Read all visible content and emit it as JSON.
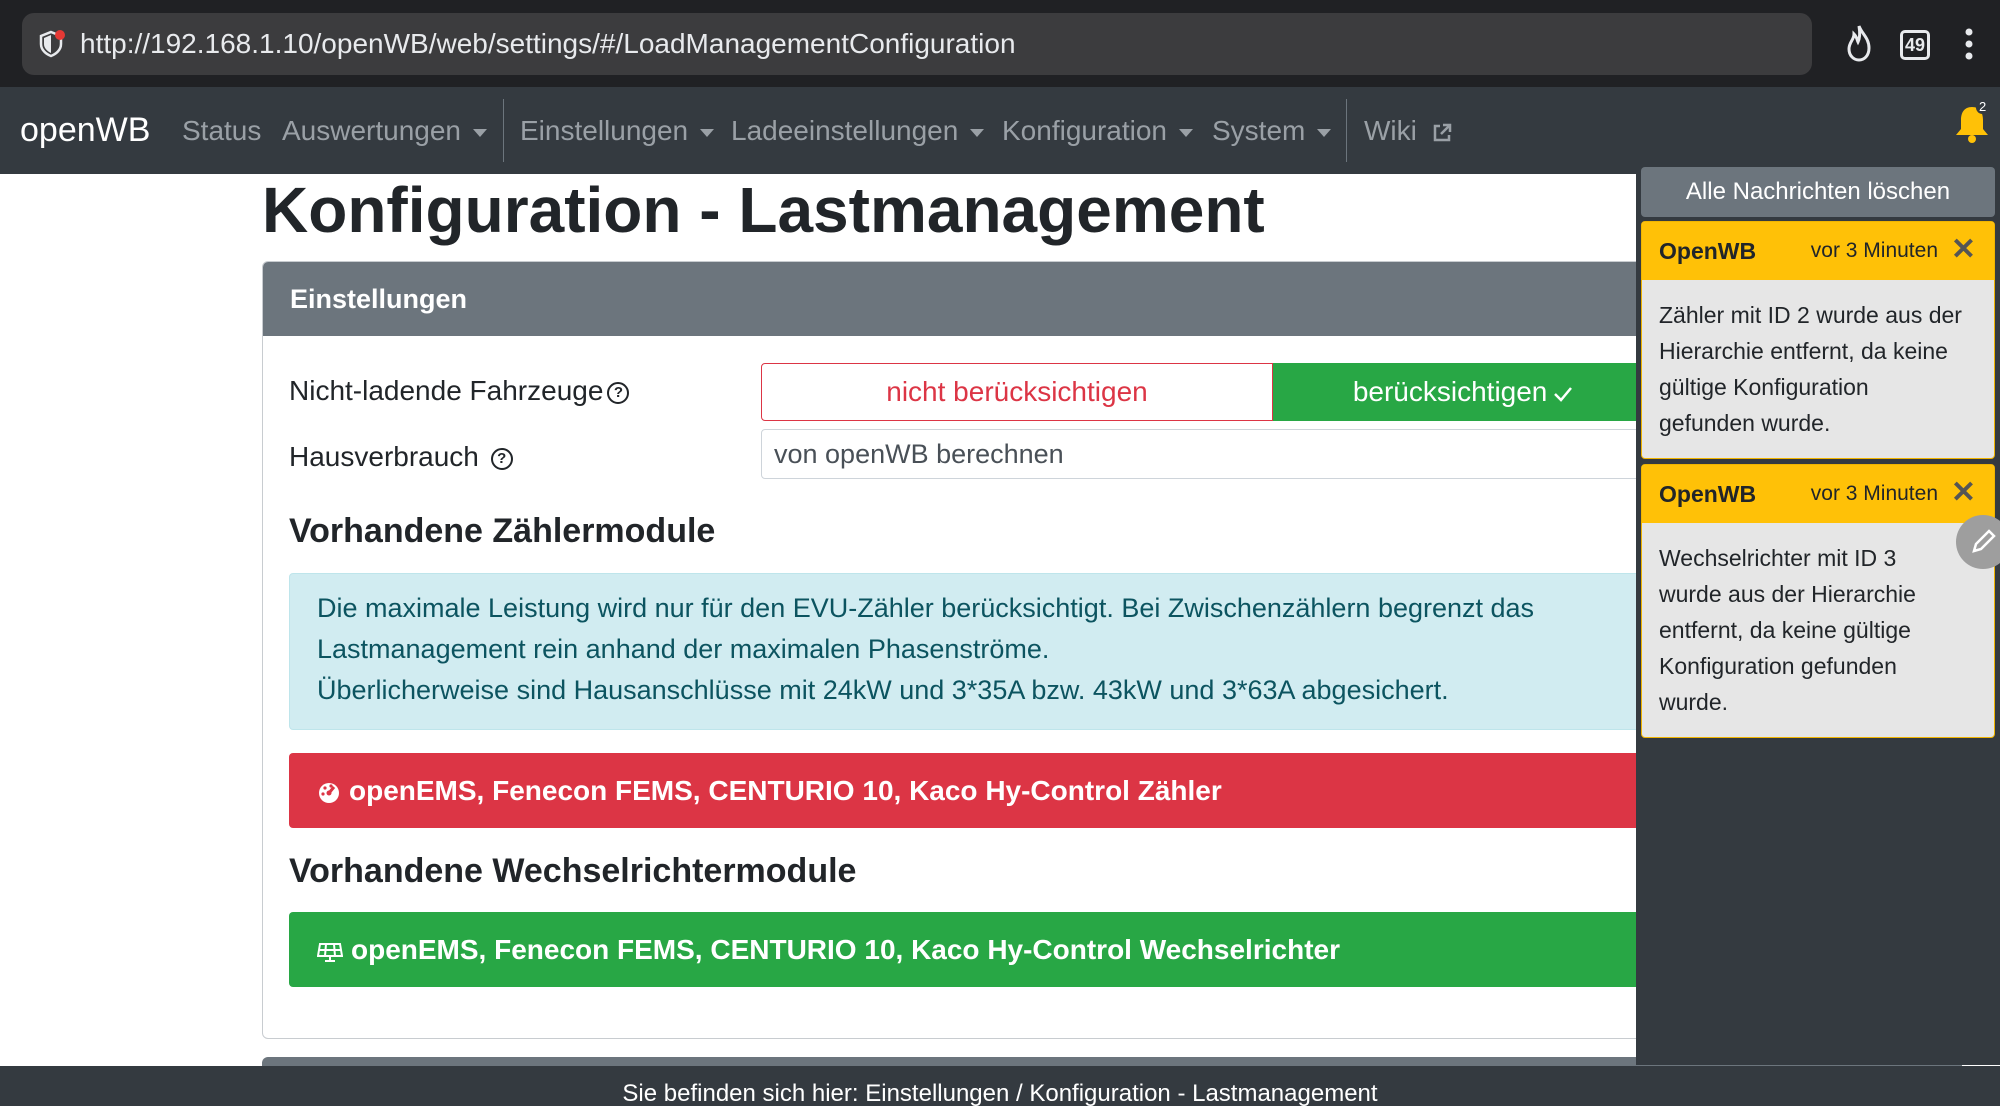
{
  "browser": {
    "url": "http://192.168.1.10/openWB/web/settings/#/LoadManagementConfiguration",
    "tab_count": "49"
  },
  "navbar": {
    "brand": "openWB",
    "items": [
      {
        "label": "Status",
        "dropdown": false
      },
      {
        "label": "Auswertungen",
        "dropdown": true
      },
      {
        "label": "Einstellungen",
        "dropdown": true
      },
      {
        "label": "Ladeeinstellungen",
        "dropdown": true
      },
      {
        "label": "Konfiguration",
        "dropdown": true
      },
      {
        "label": "System",
        "dropdown": true
      },
      {
        "label": "Wiki",
        "dropdown": false
      }
    ],
    "notification_count": "2"
  },
  "page": {
    "title": "Konfiguration - Lastmanagement"
  },
  "settings_card": {
    "header": "Einstellungen",
    "nonloading_label": "Nicht-ladende Fahrzeuge",
    "option_ignore": "nicht berücksichtigen",
    "option_consider": "berücksichtigen",
    "option_selected": "berücksichtigen",
    "house_label": "Hausverbrauch",
    "house_value": "von openWB berechnen",
    "meter_section_title": "Vorhandene Zählermodule",
    "info_lines": [
      "Die maximale Leistung wird nur für den EVU-Zähler berücksichtigt. Bei Zwischenzählern begrenzt das",
      "Lastmanagement rein anhand der maximalen Phasenströme.",
      "Überlicherweise sind Hausanschlüsse mit 24kW und 3*35A bzw. 43kW und 3*63A abgesichert."
    ],
    "meter_module": "openEMS, Fenecon FEMS, CENTURIO 10, Kaco Hy-Control Zähler",
    "inverter_section_title": "Vorhandene Wechselrichtermodule",
    "inverter_module": "openEMS, Fenecon FEMS, CENTURIO 10, Kaco Hy-Control Wechselrichter"
  },
  "footer": {
    "breadcrumb": "Sie befinden sich hier: Einstellungen / Konfiguration - Lastmanagement"
  },
  "notifications": {
    "clear_all": "Alle Nachrichten löschen",
    "items": [
      {
        "source": "OpenWB",
        "time": "vor 3 Minuten",
        "lines": [
          "Zähler mit ID 2 wurde aus der",
          "Hierarchie entfernt, da keine",
          "gültige Konfiguration",
          "gefunden wurde."
        ]
      },
      {
        "source": "OpenWB",
        "time": "vor 3 Minuten",
        "lines": [
          "Wechselrichter mit ID 3",
          "wurde aus der Hierarchie",
          "entfernt, da keine gültige",
          "Konfiguration gefunden",
          "wurde."
        ]
      }
    ]
  },
  "colors": {
    "navbar": "#343a40",
    "danger": "#dc3545",
    "success": "#28a745",
    "warning": "#ffc107",
    "info_bg": "#d1ecf1"
  }
}
